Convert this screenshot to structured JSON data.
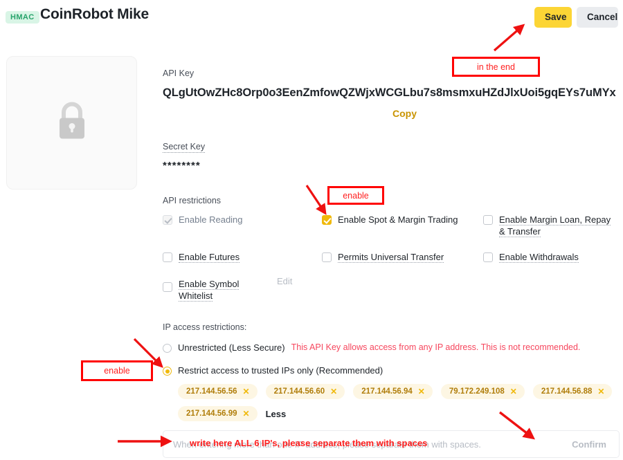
{
  "header": {
    "badge": "HMAC",
    "title": "CoinRobot Mike",
    "save_label": "Save",
    "cancel_label": "Cancel"
  },
  "qr_placeholder": {
    "icon": "lock-icon"
  },
  "api_key": {
    "label": "API Key",
    "value": "QLgUtOwZHc8Orp0o3EenZmfowQZWjxWCGLbu7s8msmxuHZdJlxUoi5gqEYs7uMYx",
    "copy_label": "Copy"
  },
  "secret_key": {
    "label": "Secret Key",
    "value": "********"
  },
  "restrictions": {
    "title": "API restrictions",
    "edit_label": "Edit",
    "items": [
      {
        "label": "Enable Reading",
        "checked": true,
        "disabled": true
      },
      {
        "label": "Enable Spot & Margin Trading",
        "checked": true,
        "disabled": false
      },
      {
        "label": "Enable Margin Loan, Repay & Transfer",
        "checked": false,
        "disabled": false
      },
      {
        "label": "Enable Futures",
        "checked": false,
        "disabled": false
      },
      {
        "label": "Permits Universal Transfer",
        "checked": false,
        "disabled": false
      },
      {
        "label": "Enable Withdrawals",
        "checked": false,
        "disabled": false
      },
      {
        "label": "Enable Symbol Whitelist",
        "checked": false,
        "disabled": false
      }
    ]
  },
  "ip_restrictions": {
    "title": "IP access restrictions:",
    "option_unrestricted": "Unrestricted (Less Secure)",
    "unrestricted_warning": "This API Key allows access from any IP address. This is not recommended.",
    "option_restricted": "Restrict access to trusted IPs only (Recommended)",
    "selected": "restricted",
    "ips": [
      "217.144.56.56",
      "217.144.56.60",
      "217.144.56.94",
      "79.172.249.108",
      "217.144.56.88",
      "217.144.56.99"
    ],
    "remove_glyph": "✕",
    "less_label": "Less",
    "input_value": "",
    "input_placeholder": "When entering more than one IP address, please separate them with spaces.",
    "confirm_label": "Confirm"
  },
  "annotations": {
    "in_the_end": "in the end",
    "enable_spot": "enable",
    "enable_ip": "enable",
    "write_here": "write here ALL 6 IP's, please separate them with spaces"
  },
  "colors": {
    "brand_yellow": "#f0b90b",
    "save_yellow": "#fcd535",
    "annotation_red": "#ff2020",
    "warning_red": "#f6465d",
    "badge_green": "#27a36b"
  }
}
